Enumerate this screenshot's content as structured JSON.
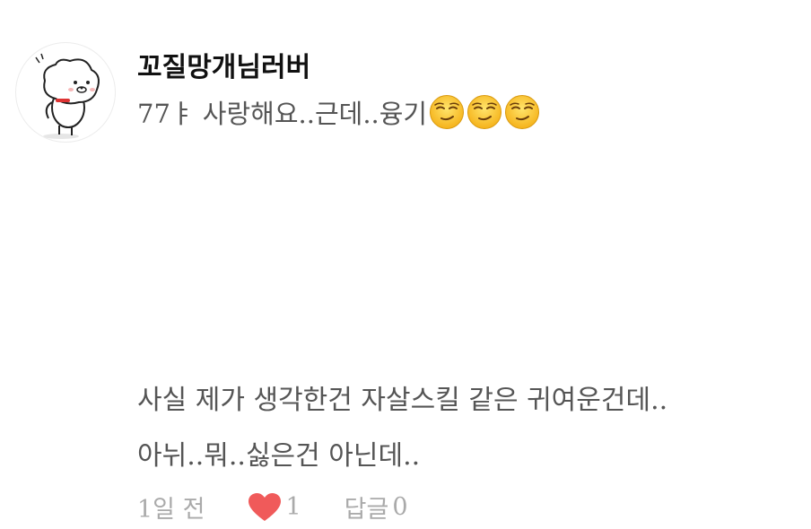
{
  "comment": {
    "username": "꼬질망개님러버",
    "first_line_text": "77ㅑ 사랑해요..근데..융기",
    "emojis": [
      "smirk-face-icon",
      "smirk-face-icon",
      "smirk-face-icon"
    ],
    "body_lines": [
      "사실 제가 생각한건 자살스킬 같은 귀여운건데..",
      "아뉘..뭐..싫은건 아닌데.."
    ],
    "time": "1일 전",
    "like_count": "1",
    "reply_label": "답글",
    "reply_count": "0"
  },
  "colors": {
    "heart": "#f05a5a",
    "meta_text": "#aaaaaa",
    "body_text": "#555555",
    "username": "#111111"
  }
}
